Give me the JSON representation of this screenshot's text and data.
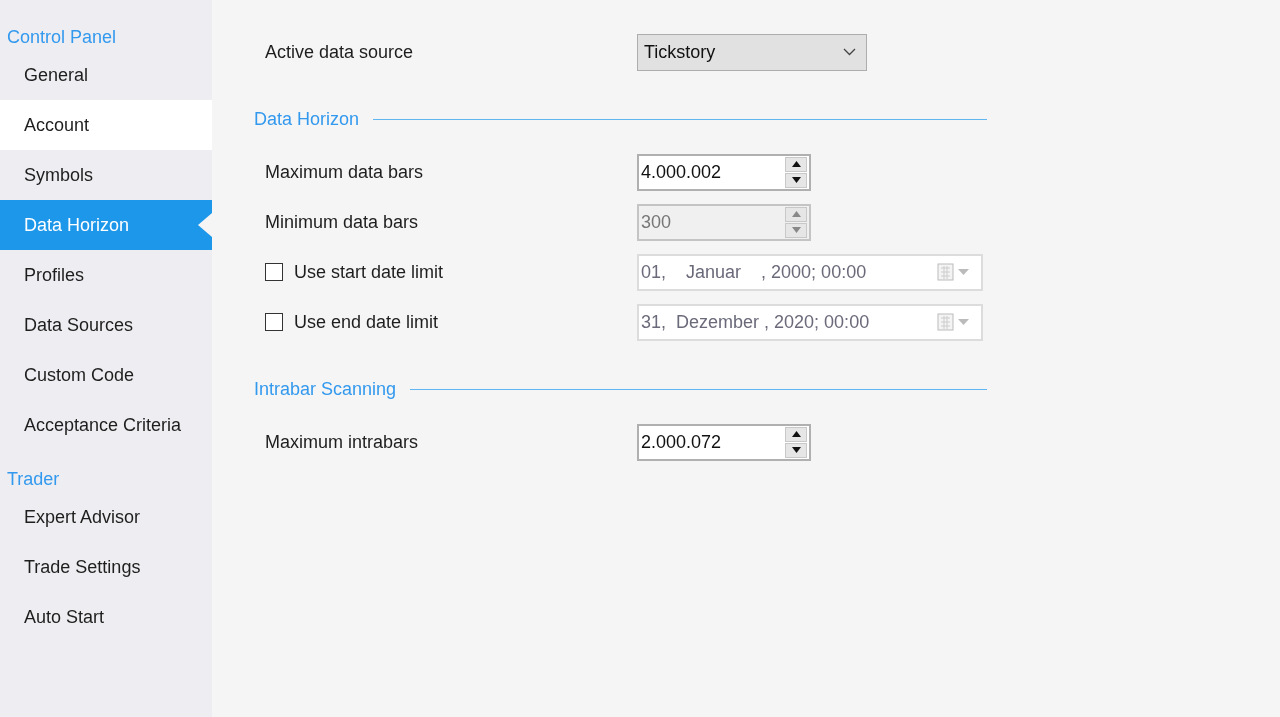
{
  "sidebar": {
    "groups": [
      {
        "title": "Control Panel",
        "items": [
          {
            "label": "General",
            "selected": false,
            "hovered": false
          },
          {
            "label": "Account",
            "selected": false,
            "hovered": true
          },
          {
            "label": "Symbols",
            "selected": false,
            "hovered": false
          },
          {
            "label": "Data Horizon",
            "selected": true,
            "hovered": false
          },
          {
            "label": "Profiles",
            "selected": false,
            "hovered": false
          },
          {
            "label": "Data Sources",
            "selected": false,
            "hovered": false
          },
          {
            "label": "Custom Code",
            "selected": false,
            "hovered": false
          },
          {
            "label": "Acceptance Criteria",
            "selected": false,
            "hovered": false
          }
        ]
      },
      {
        "title": "Trader",
        "items": [
          {
            "label": "Expert Advisor",
            "selected": false,
            "hovered": false
          },
          {
            "label": "Trade Settings",
            "selected": false,
            "hovered": false
          },
          {
            "label": "Auto Start",
            "selected": false,
            "hovered": false
          }
        ]
      }
    ]
  },
  "data_source": {
    "label": "Active data source",
    "value": "Tickstory"
  },
  "sections": [
    {
      "title": "Data Horizon",
      "rows": [
        {
          "kind": "spinner",
          "label": "Maximum data bars",
          "value": "4.000.002",
          "disabled": false
        },
        {
          "kind": "spinner",
          "label": "Minimum data bars",
          "value": "300",
          "disabled": true
        },
        {
          "kind": "date",
          "label": "Use start date limit",
          "checked": false,
          "value": "01,    Januar    , 2000; 00:00"
        },
        {
          "kind": "date",
          "label": "Use end date limit",
          "checked": false,
          "value": "31,  Dezember , 2020; 00:00"
        }
      ]
    },
    {
      "title": "Intrabar Scanning",
      "rows": [
        {
          "kind": "spinner",
          "label": "Maximum intrabars",
          "value": "2.000.072",
          "disabled": false
        }
      ]
    }
  ]
}
